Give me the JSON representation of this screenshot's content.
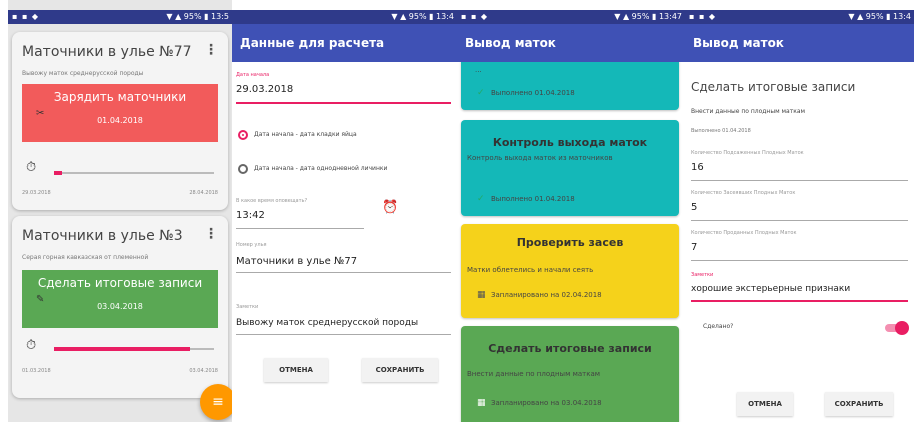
{
  "colors": {
    "appbar": "#3f51b5",
    "accent": "#e91e63",
    "red": "#f25b5b",
    "green": "#5aa854",
    "teal": "#14b8b8",
    "yellow": "#f5d21b",
    "fab": "#ff9800"
  },
  "screen1": {
    "status_left": "▪ ▪ ◆",
    "status_right": "▼ ▲ 95% ▮ 13:5",
    "card1": {
      "title": "Маточники в улье №77",
      "menu": "⋮",
      "subtitle": "Вывожу маток среднерусской породы",
      "block_title": "Зарядить маточники",
      "block_date": "01.04.2018",
      "block_icon": "✂",
      "timer_icon": "⏱",
      "progress": 0.05,
      "date_start": "29.03.2018",
      "date_end": "28.04.2018"
    },
    "card2": {
      "title": "Маточники в улье №3",
      "menu": "⋮",
      "subtitle": "Серая горная кавказская от племенной",
      "block_title": "Сделать итоговые записи",
      "block_date": "03.04.2018",
      "block_icon": "✎",
      "timer_icon": "⏱",
      "progress": 0.85,
      "date_start": "01.03.2018",
      "date_end": "03.04.2018"
    },
    "fab_icon": "≡"
  },
  "screen2": {
    "status_right": "▼ ▲ 95% ▮ 13:4",
    "title": "Данные для расчета",
    "start_label": "Дата начала",
    "start_value": "29.03.2018",
    "radio1": "Дата начала - дата кладки яйца",
    "radio2": "Дата начала - дата однодневной личинки",
    "time_label": "В какое время оповещать?",
    "time_value": "13:42",
    "alarm_icon": "⏰",
    "hive_label": "Номер улья",
    "hive_value": "Маточники в улье №77",
    "notes_label": "Заметки",
    "notes_value": "Вывожу маток среднерусской породы",
    "cancel": "ОТМЕНА",
    "save": "СОХРАНИТЬ"
  },
  "screen3": {
    "status_left": "▪ ▪ ◆",
    "status_right": "▼ ▲ 95% ▮ 13:47",
    "title": "Вывод маток",
    "card0": {
      "top_cut": "...",
      "footer": "Выполнено 01.04.2018",
      "icon": "✓"
    },
    "card1": {
      "header": "Контроль выхода маток",
      "subtitle": "Контроль выхода маток из маточников",
      "footer": "Выполнено 01.04.2018",
      "icon": "✓"
    },
    "card2": {
      "header": "Проверить засев",
      "subtitle": "Матки облетелись и начали сеять",
      "footer": "Запланировано на 02.04.2018",
      "icon": "▦"
    },
    "card3": {
      "header": "Сделать итоговые записи",
      "subtitle": "Внести данные по плодным маткам",
      "footer": "Запланировано на 03.04.2018",
      "icon": "▦"
    }
  },
  "screen4": {
    "status_left": "▪ ▪ ◆",
    "status_right": "▼ ▲ 95% ▮ 13:4",
    "title": "Вывод маток",
    "heading": "Сделать итоговые записи",
    "desc": "Внести данные по плодным маткам",
    "done_date": "Выполнено 01.04.2018",
    "f1_label": "Количество Подсаженных Плодных Маток",
    "f1_value": "16",
    "f2_label": "Количество Засеявших Плодных Маток",
    "f2_value": "5",
    "f3_label": "Количество Проданных Плодных Маток",
    "f3_value": "7",
    "f4_label": "Заметки",
    "f4_value": "хорошие экстерьерные признаки",
    "done_label": "Сделано?",
    "cancel": "ОТМЕНА",
    "save": "СОХРАНИТЬ"
  }
}
